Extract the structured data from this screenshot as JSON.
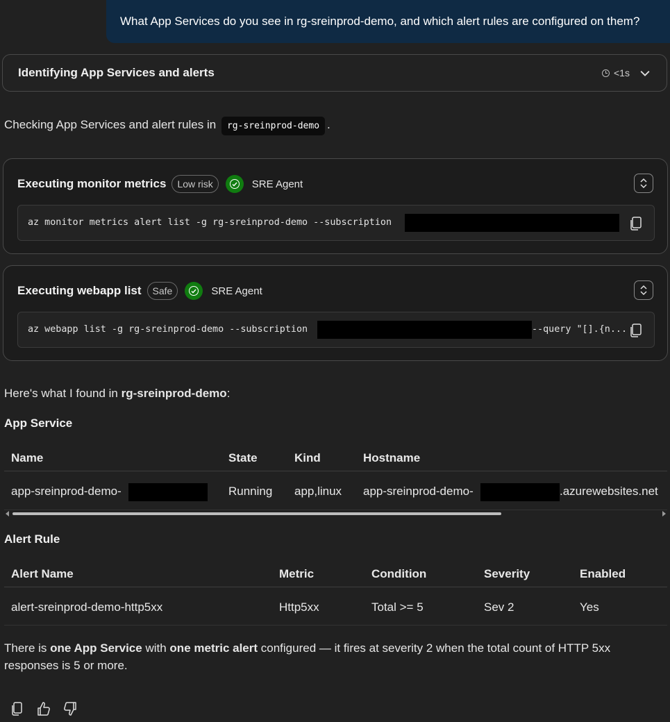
{
  "user_message": "What App Services do you see in rg-sreinprod-demo, and which alert rules are configured on them?",
  "thinking": {
    "title": "Identifying App Services and alerts",
    "duration": "<1s"
  },
  "intro": {
    "text": "Checking App Services and alert rules in",
    "code": "rg-sreinprod-demo",
    "suffix": "."
  },
  "tool_calls": [
    {
      "title": "Executing monitor metrics",
      "risk": "Low risk",
      "agent": "SRE Agent",
      "command": "az monitor metrics alert list -g rg-sreinprod-demo --subscription"
    },
    {
      "title": "Executing webapp list",
      "risk": "Safe",
      "agent": "SRE Agent",
      "command": "az webapp list -g rg-sreinprod-demo --subscription",
      "command_tail": "--query \"[].{n..."
    }
  ],
  "found": {
    "prefix": "Here's what I found in ",
    "rg": "rg-sreinprod-demo",
    "suffix": ":"
  },
  "app_service": {
    "heading": "App Service",
    "columns": [
      "Name",
      "State",
      "Kind",
      "Hostname"
    ],
    "rows": [
      {
        "name": "app-sreinprod-demo-",
        "state": "Running",
        "kind": "app,linux",
        "host_prefix": "app-sreinprod-demo-",
        "host_suffix": ".azurewebsites.net"
      }
    ]
  },
  "alert_rule": {
    "heading": "Alert Rule",
    "columns": [
      "Alert Name",
      "Metric",
      "Condition",
      "Severity",
      "Enabled"
    ],
    "rows": [
      {
        "name": "alert-sreinprod-demo-http5xx",
        "metric": "Http5xx",
        "condition": "Total >= 5",
        "severity": "Sev 2",
        "enabled": "Yes"
      }
    ]
  },
  "summary": {
    "p1": "There is ",
    "b1": "one App Service",
    "p2": " with ",
    "b2": "one metric alert",
    "p3": " configured — it fires at severity 2 when the total count of HTTP 5xx",
    "line2": "responses is 5 or more."
  },
  "icons": [
    "clock-icon",
    "chevron-down-icon",
    "check-circle-icon",
    "expand-collapse-icon",
    "copy-icon",
    "thumbs-up-icon",
    "thumbs-down-icon"
  ],
  "colors": {
    "user_bubble": "#0f2a44",
    "success": "#107c10",
    "background": "#212121"
  }
}
